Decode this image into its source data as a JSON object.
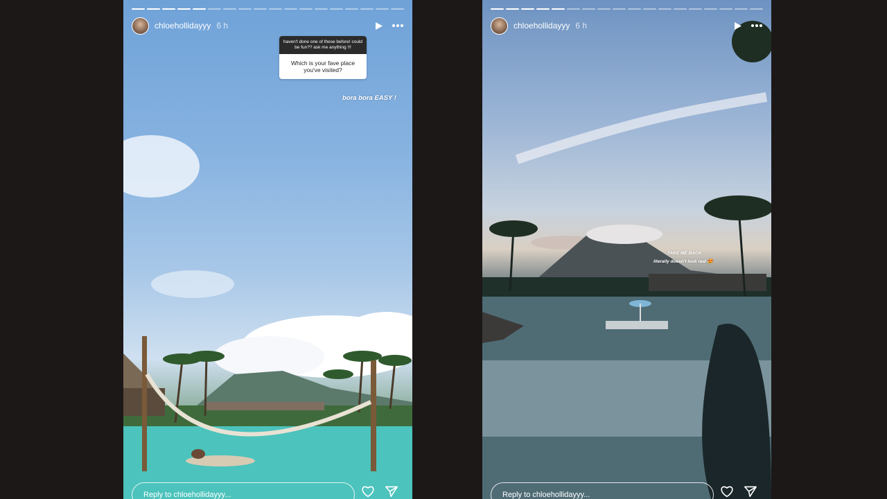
{
  "stories": [
    {
      "username": "chloehollidayyy",
      "time": "6 h",
      "progress": {
        "total": 18,
        "current": 5
      },
      "question_sticker": {
        "prompt": "haven't done one of these before! could be fun?? ask me anything !!!",
        "question": "Which is your fave place you've visited?"
      },
      "answer_text": "bora bora EASY !",
      "reply_placeholder": "Reply to chloehollidayyy..."
    },
    {
      "username": "chloehollidayyy",
      "time": "6 h",
      "progress": {
        "total": 18,
        "current": 5
      },
      "caption_line1": "TAKE ME BACK",
      "caption_line2": "literally doesn't look real 😍",
      "reply_placeholder": "Reply to chloehollidayyy..."
    }
  ],
  "icons": {
    "play": "play-icon",
    "more": "more-options-icon",
    "like": "heart-icon",
    "share": "send-icon"
  }
}
